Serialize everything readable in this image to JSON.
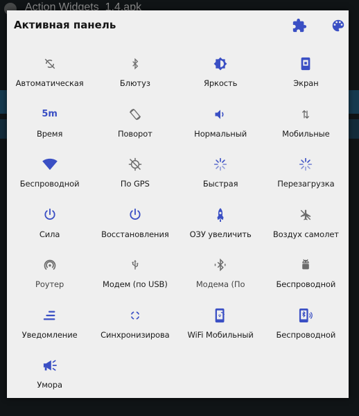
{
  "background": {
    "title": "Action Widgets_1.4.apk"
  },
  "panel": {
    "title": "Активная панель"
  },
  "header_icons": [
    "puzzle-icon",
    "palette-icon"
  ],
  "colors": {
    "accent": "#3a4fc4",
    "inactive": "#6b6b6b",
    "panel_bg": "#efefef"
  },
  "tiles": [
    {
      "label": "Автоматическая",
      "icon": "auto-rotate-off-icon",
      "active": false
    },
    {
      "label": "Блютуз",
      "icon": "bluetooth-icon",
      "active": false
    },
    {
      "label": "Яркость",
      "icon": "brightness-icon",
      "active": true
    },
    {
      "label": "Экран",
      "icon": "phone-screen-icon",
      "active": true
    },
    {
      "label": "Время",
      "icon": "screen-timeout-icon",
      "active": true,
      "value": "5m"
    },
    {
      "label": "Поворот",
      "icon": "screen-rotation-icon",
      "active": false
    },
    {
      "label": "Нормальный",
      "icon": "sound-volume-icon",
      "active": true
    },
    {
      "label": "Мобильные",
      "icon": "mobile-data-icon",
      "active": false
    },
    {
      "label": "Беспроводной",
      "icon": "wifi-icon",
      "active": true
    },
    {
      "label": "По GPS",
      "icon": "gps-off-icon",
      "active": false
    },
    {
      "label": "Быстрая",
      "icon": "loading-spinner-icon",
      "active": true
    },
    {
      "label": "Перезагрузка",
      "icon": "loading-spinner-icon",
      "active": true
    },
    {
      "label": "Сила",
      "icon": "power-icon",
      "active": true
    },
    {
      "label": "Восстановления",
      "icon": "power-icon",
      "active": true
    },
    {
      "label": "ОЗУ увеличить",
      "icon": "rocket-icon",
      "active": true
    },
    {
      "label": "Воздух самолет",
      "icon": "airplane-off-icon",
      "active": false
    },
    {
      "label": "Роутер",
      "icon": "hotspot-icon",
      "active": false
    },
    {
      "label": "Модем (по USB)",
      "icon": "usb-icon",
      "active": false
    },
    {
      "label": "Модема (По",
      "icon": "bluetooth-tether-icon",
      "active": false
    },
    {
      "label": "Беспроводной",
      "icon": "android-icon",
      "active": false
    },
    {
      "label": "Уведомление",
      "icon": "notification-lines-icon",
      "active": true
    },
    {
      "label": "Синхронизирова",
      "icon": "sync-icon",
      "active": true
    },
    {
      "label": "WiFi Мобильный",
      "icon": "wifi-hotspot-phone-icon",
      "active": true
    },
    {
      "label": "Беспроводной",
      "icon": "phone-bluetooth-icon",
      "active": true
    },
    {
      "label": "Умора",
      "icon": "megaphone-icon",
      "active": true
    }
  ]
}
